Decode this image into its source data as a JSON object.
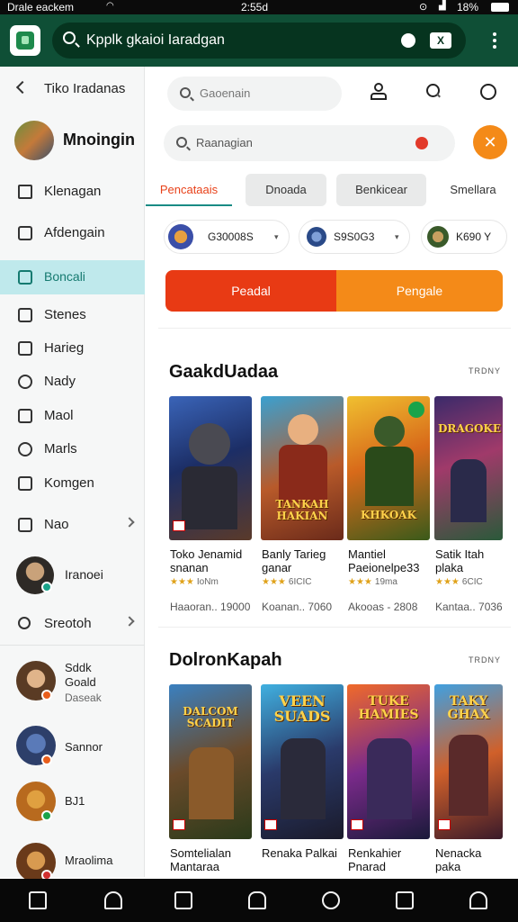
{
  "status_bar": {
    "left_text": "Drale eackem",
    "time": "2:55d",
    "battery": "18%"
  },
  "app_bar": {
    "search_text": "Kpplk gkaioi Iaradgan",
    "action_label": "X"
  },
  "sidebar": {
    "items": [
      {
        "label": "Tiko Iradanas"
      },
      {
        "label": "Klenagan"
      },
      {
        "label": "Afdengain"
      },
      {
        "label": "Boncali"
      },
      {
        "label": "Stenes"
      },
      {
        "label": "Harieg"
      },
      {
        "label": "Nady"
      },
      {
        "label": "Maol"
      },
      {
        "label": "Marls"
      },
      {
        "label": "Komgen"
      },
      {
        "label": "Nao"
      },
      {
        "label": "Sreotoh"
      }
    ],
    "profile_name": "Mnoingin",
    "account_label": "Iranoei",
    "friends": [
      {
        "name": "Sddk Goald",
        "status": "Daseak"
      },
      {
        "name": "Sannor",
        "status": ""
      },
      {
        "name": "BJ1",
        "status": ""
      },
      {
        "name": "Mraolima",
        "status": ""
      }
    ]
  },
  "main": {
    "top_search_placeholder": "Gaoenain",
    "search2_text": "Raanagian",
    "tabs": [
      {
        "label": "Pencataais"
      },
      {
        "label": "Dnoada"
      },
      {
        "label": "Benkicear"
      },
      {
        "label": "Smellara"
      }
    ],
    "chips": [
      {
        "label": "G30008S"
      },
      {
        "label": "S9S0G3"
      },
      {
        "label": "K690 Y"
      }
    ],
    "buttons": {
      "left": "Peadal",
      "right": "Pengale"
    },
    "sections": [
      {
        "title": "GaakdUadaa",
        "more": "TRDNY",
        "cards": [
          {
            "title": "Toko Jenamid snanan",
            "rating": "★★★",
            "rating_note": "IoNm",
            "meta": "Haaoran.. 19000",
            "art_text": ""
          },
          {
            "title": "Banly Tarieg ganar",
            "rating": "★★★",
            "rating_note": "6ICIC",
            "meta": "Koanan.. 7060",
            "art_text": "TANKAH HAKIAN"
          },
          {
            "title": "Mantiel Paeionelpe33",
            "rating": "★★★",
            "rating_note": "19ma",
            "meta": "Akooas - 2808",
            "art_text": "KHKOAK"
          },
          {
            "title": "Satik Itah plaka",
            "rating": "★★★",
            "rating_note": "6CIC",
            "meta": "Kantaa.. 7036",
            "art_text": "DRAGOKE"
          }
        ]
      },
      {
        "title": "DolronKapah",
        "more": "TRDNY",
        "cards": [
          {
            "title": "Somtelialan Mantaraa",
            "art_text": "DALCOM SCADIT"
          },
          {
            "title": "Renaka Palkai",
            "art_text": "VEEN SUADS"
          },
          {
            "title": "Renkahier Pnarad",
            "art_text": "TUKE HAMIES"
          },
          {
            "title": "Nenacka paka",
            "art_text": "TAKY GHAX"
          }
        ]
      }
    ]
  },
  "colors": {
    "app_bar": "#0f4f36",
    "accent_green": "#157a70",
    "orange": "#f48a18",
    "red": "#e83a14"
  }
}
